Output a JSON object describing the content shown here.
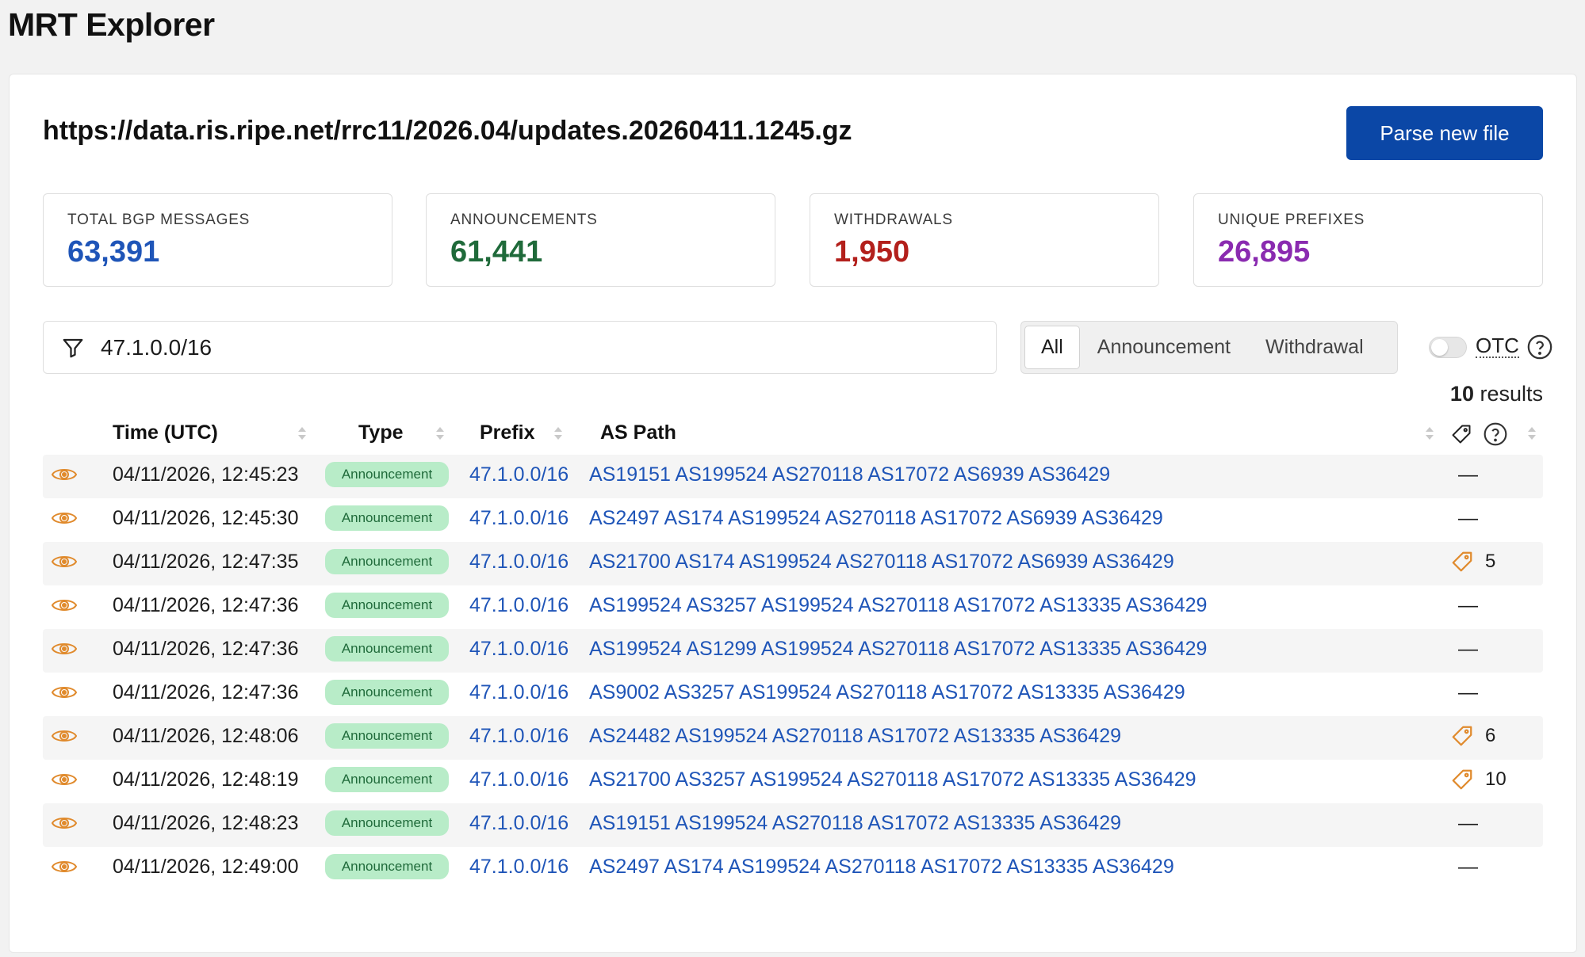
{
  "app": {
    "title": "MRT Explorer"
  },
  "file": {
    "url": "https://data.ris.ripe.net/rrc11/2026.04/updates.20260411.1245.gz",
    "parse_label": "Parse new file"
  },
  "stats": [
    {
      "label": "Total BGP Messages",
      "value": "63,391",
      "color": "#1f55b8"
    },
    {
      "label": "Announcements",
      "value": "61,441",
      "color": "#1f6a3a"
    },
    {
      "label": "Withdrawals",
      "value": "1,950",
      "color": "#b3201c"
    },
    {
      "label": "Unique Prefixes",
      "value": "26,895",
      "color": "#8a2bb0"
    }
  ],
  "filter": {
    "value": "47.1.0.0/16",
    "icon": "filter-icon"
  },
  "segments": {
    "all": "All",
    "announcement": "Announcement",
    "withdrawal": "Withdrawal",
    "selected": "All"
  },
  "otc": {
    "label": "OTC",
    "enabled": false
  },
  "results": {
    "count": "10",
    "suffix": " results"
  },
  "columns": {
    "time": "Time (UTC)",
    "type": "Type",
    "prefix": "Prefix",
    "as_path": "AS Path"
  },
  "colors": {
    "eye": "#e08a2c",
    "tag": "#e08a2c",
    "link": "#1f55b8"
  },
  "rows": [
    {
      "time": "04/11/2026, 12:45:23",
      "type": "Announcement",
      "prefix": "47.1.0.0/16",
      "as_path": "AS19151 AS199524 AS270118 AS17072 AS6939 AS36429",
      "tag": "—",
      "has_tag": false
    },
    {
      "time": "04/11/2026, 12:45:30",
      "type": "Announcement",
      "prefix": "47.1.0.0/16",
      "as_path": "AS2497 AS174 AS199524 AS270118 AS17072 AS6939 AS36429",
      "tag": "—",
      "has_tag": false
    },
    {
      "time": "04/11/2026, 12:47:35",
      "type": "Announcement",
      "prefix": "47.1.0.0/16",
      "as_path": "AS21700 AS174 AS199524 AS270118 AS17072 AS6939 AS36429",
      "tag": "5",
      "has_tag": true
    },
    {
      "time": "04/11/2026, 12:47:36",
      "type": "Announcement",
      "prefix": "47.1.0.0/16",
      "as_path": "AS199524 AS3257 AS199524 AS270118 AS17072 AS13335 AS36429",
      "tag": "—",
      "has_tag": false
    },
    {
      "time": "04/11/2026, 12:47:36",
      "type": "Announcement",
      "prefix": "47.1.0.0/16",
      "as_path": "AS199524 AS1299 AS199524 AS270118 AS17072 AS13335 AS36429",
      "tag": "—",
      "has_tag": false
    },
    {
      "time": "04/11/2026, 12:47:36",
      "type": "Announcement",
      "prefix": "47.1.0.0/16",
      "as_path": "AS9002 AS3257 AS199524 AS270118 AS17072 AS13335 AS36429",
      "tag": "—",
      "has_tag": false
    },
    {
      "time": "04/11/2026, 12:48:06",
      "type": "Announcement",
      "prefix": "47.1.0.0/16",
      "as_path": "AS24482 AS199524 AS270118 AS17072 AS13335 AS36429",
      "tag": "6",
      "has_tag": true
    },
    {
      "time": "04/11/2026, 12:48:19",
      "type": "Announcement",
      "prefix": "47.1.0.0/16",
      "as_path": "AS21700 AS3257 AS199524 AS270118 AS17072 AS13335 AS36429",
      "tag": "10",
      "has_tag": true
    },
    {
      "time": "04/11/2026, 12:48:23",
      "type": "Announcement",
      "prefix": "47.1.0.0/16",
      "as_path": "AS19151 AS199524 AS270118 AS17072 AS13335 AS36429",
      "tag": "—",
      "has_tag": false
    },
    {
      "time": "04/11/2026, 12:49:00",
      "type": "Announcement",
      "prefix": "47.1.0.0/16",
      "as_path": "AS2497 AS174 AS199524 AS270118 AS17072 AS13335 AS36429",
      "tag": "—",
      "has_tag": false
    }
  ]
}
